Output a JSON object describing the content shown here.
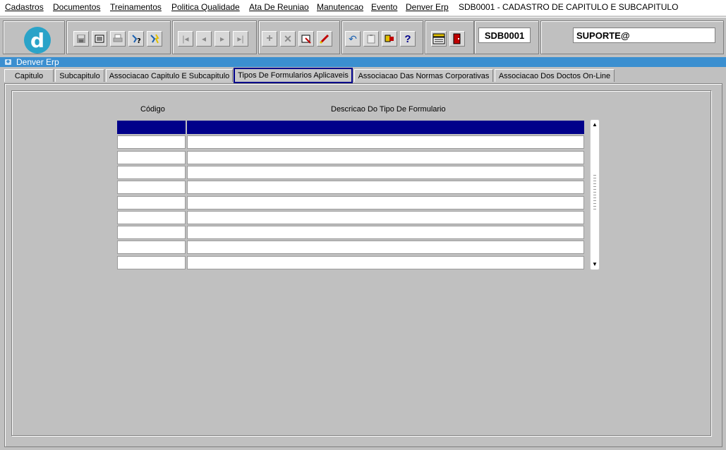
{
  "menu": {
    "items": [
      "Cadastros",
      "Documentos",
      "Treinamentos",
      "Politica Qualidade",
      "Ata De Reuniao",
      "Manutencao",
      "Evento",
      "Denver Erp"
    ],
    "title": "SDB0001 - CADASTRO DE CAPITULO E SUBCAPITULO"
  },
  "toolbar": {
    "logo_letter": "d",
    "form_code": "SDB0001",
    "user": "SUPORTE@",
    "icons": {
      "save": "save-icon",
      "print": "print-icon",
      "exit": "exit-icon",
      "help": "help-icon",
      "menu": "menu-icon"
    }
  },
  "window": {
    "title": "Denver Erp"
  },
  "tabs": [
    "Capitulo",
    "Subcapitulo",
    "Associacao Capitulo E Subcapitulo",
    "Tipos De Formularios Aplicaveis",
    "Associacao Das Normas Corporativas",
    "Associacao Dos Doctos On-Line"
  ],
  "active_tab": "Tipos De Formularios Aplicaveis",
  "grid": {
    "col_code": "Código",
    "col_desc": "Descricao Do Tipo De Formulario",
    "rows": 10,
    "selected_row": 1
  },
  "colors": {
    "selection": "#00008a",
    "title_strip": "#3b8fd0",
    "background": "#c0c0c0"
  }
}
